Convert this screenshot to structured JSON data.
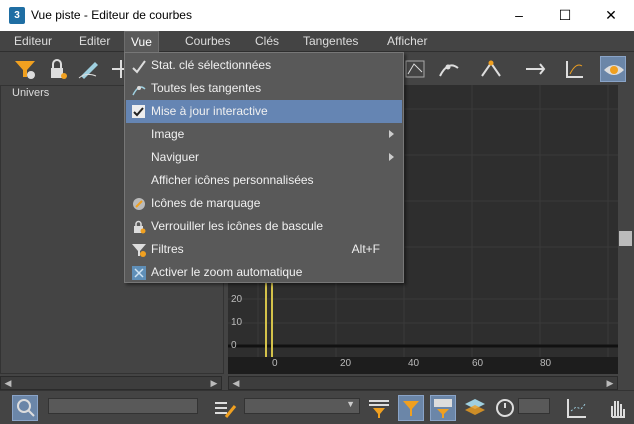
{
  "window": {
    "app_icon_text": "3",
    "title": "Vue piste - Editeur de courbes",
    "minimize": "–",
    "maximize": "☐",
    "close": "✕"
  },
  "menubar": {
    "items": [
      "Editeur",
      "Editer",
      "Vue",
      "Courbes",
      "Clés",
      "Tangentes",
      "Afficher"
    ],
    "active": "Vue"
  },
  "dropdown": {
    "items": [
      {
        "label": "Stat. clé sélectionnées",
        "icon": "key-stats-icon"
      },
      {
        "label": "Toutes les tangentes",
        "icon": "all-tangents-icon"
      },
      {
        "label": "Mise à jour interactive",
        "icon": "checkbox-checked-icon",
        "checked": true,
        "highlighted": true
      },
      {
        "label": "Image",
        "submenu": true
      },
      {
        "label": "Naviguer",
        "submenu": true
      },
      {
        "label": "Afficher icônes personnalisées"
      },
      {
        "label": "Icônes de marquage",
        "icon": "marking-icons-icon"
      },
      {
        "label": "Verrouiller les icônes de bascule",
        "icon": "lock-toggle-icon"
      },
      {
        "label": "Filtres",
        "icon": "filter-icon",
        "shortcut": "Alt+F"
      },
      {
        "label": "Activer le zoom automatique",
        "icon": "auto-zoom-icon"
      }
    ]
  },
  "left_panel": {
    "root_label": "Univers"
  },
  "graph": {
    "y_labels": [
      "20",
      "10",
      "0"
    ],
    "x_labels": [
      "0",
      "20",
      "40",
      "60",
      "80"
    ]
  },
  "colors": {
    "background": "#444444",
    "graph_bg": "#2e2e2e",
    "menu_highlight": "#6585b3",
    "time_slider": "#d4c24a",
    "accent_orange": "#f0a020"
  }
}
